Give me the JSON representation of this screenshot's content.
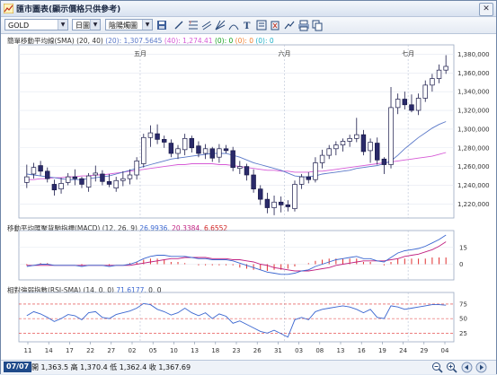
{
  "window": {
    "title": "匯市圖表(顯示價格只供參考)",
    "close_label": "✕"
  },
  "toolbar": {
    "symbol": "GOLD",
    "period": "日圖",
    "chart_style": "陰陽燭圖"
  },
  "price_panel": {
    "indicator_name": "簡單移動平均線(SMA) (20, 40)",
    "val_20": "(20): 1,307.5645",
    "val_40": "(40): 1,274.41",
    "z1": "(0): 0",
    "z2": "(0): 0",
    "z3": "(0): 0",
    "month_labels": [
      "五月",
      "六月",
      "七月"
    ],
    "price_labels": [
      "1,380,000",
      "1,360,000",
      "1,340,000",
      "1,320,000",
      "1,300,000",
      "1,280,000",
      "1,260,000",
      "1,240,000",
      "1,220,000"
    ]
  },
  "macd_panel": {
    "title": "移動平均匯聚背馳指標(MACD) (12, 26, 9)",
    "v1": "26.9936,",
    "v2": "20.3384,",
    "v3": "6.6552",
    "axis_labels": [
      "15",
      "0"
    ]
  },
  "rsi_panel": {
    "title": "相對強弱指數(RSI-SMA) (14, 0, 0)",
    "v1": "71.6177,",
    "v2": "0, 0",
    "axis_labels": [
      "75",
      "50",
      "25"
    ]
  },
  "date_axis": [
    "11",
    "14",
    "17",
    "22",
    "27",
    "02",
    "05",
    "10",
    "13",
    "18",
    "23",
    "26",
    "31",
    "03",
    "08",
    "13",
    "16",
    "19",
    "24",
    "29",
    "04"
  ],
  "status": {
    "date": "07/07",
    "quote": "開 1,363.5 高 1,370.4 低 1,362.4 收 1,367.69"
  },
  "colors": {
    "up_candle": "#ffffff",
    "down_candle": "#2a2a6a",
    "sma20": "#5a78c8",
    "sma40": "#d65ad6",
    "macd": "#3a66d0",
    "signal": "#c02080",
    "histogram": "#e03030",
    "rsi": "#3a66d0",
    "rsi_levels": "#e03030"
  },
  "chart_data": {
    "type": "candlestick",
    "symbol": "GOLD",
    "interval": "daily",
    "ylim": [
      1205,
      1390
    ],
    "candles": [
      {
        "o": 1243,
        "h": 1262,
        "l": 1237,
        "c": 1249
      },
      {
        "o": 1252,
        "h": 1264,
        "l": 1247,
        "c": 1259
      },
      {
        "o": 1261,
        "h": 1266,
        "l": 1250,
        "c": 1255
      },
      {
        "o": 1255,
        "h": 1259,
        "l": 1243,
        "c": 1247
      },
      {
        "o": 1241,
        "h": 1246,
        "l": 1229,
        "c": 1235
      },
      {
        "o": 1236,
        "h": 1248,
        "l": 1231,
        "c": 1242
      },
      {
        "o": 1243,
        "h": 1253,
        "l": 1240,
        "c": 1249
      },
      {
        "o": 1249,
        "h": 1257,
        "l": 1240,
        "c": 1247
      },
      {
        "o": 1247,
        "h": 1249,
        "l": 1237,
        "c": 1241
      },
      {
        "o": 1238,
        "h": 1253,
        "l": 1233,
        "c": 1250
      },
      {
        "o": 1251,
        "h": 1261,
        "l": 1244,
        "c": 1253
      },
      {
        "o": 1252,
        "h": 1256,
        "l": 1240,
        "c": 1244
      },
      {
        "o": 1244,
        "h": 1252,
        "l": 1238,
        "c": 1241
      },
      {
        "o": 1237,
        "h": 1249,
        "l": 1233,
        "c": 1245
      },
      {
        "o": 1245,
        "h": 1255,
        "l": 1239,
        "c": 1247
      },
      {
        "o": 1247,
        "h": 1257,
        "l": 1241,
        "c": 1251
      },
      {
        "o": 1251,
        "h": 1270,
        "l": 1246,
        "c": 1266
      },
      {
        "o": 1263,
        "h": 1295,
        "l": 1259,
        "c": 1291
      },
      {
        "o": 1291,
        "h": 1304,
        "l": 1281,
        "c": 1296
      },
      {
        "o": 1295,
        "h": 1305,
        "l": 1284,
        "c": 1289
      },
      {
        "o": 1289,
        "h": 1293,
        "l": 1280,
        "c": 1286
      },
      {
        "o": 1285,
        "h": 1289,
        "l": 1270,
        "c": 1274
      },
      {
        "o": 1274,
        "h": 1283,
        "l": 1268,
        "c": 1279
      },
      {
        "o": 1278,
        "h": 1295,
        "l": 1272,
        "c": 1290
      },
      {
        "o": 1290,
        "h": 1293,
        "l": 1275,
        "c": 1280
      },
      {
        "o": 1282,
        "h": 1287,
        "l": 1270,
        "c": 1274
      },
      {
        "o": 1274,
        "h": 1284,
        "l": 1268,
        "c": 1279
      },
      {
        "o": 1279,
        "h": 1281,
        "l": 1265,
        "c": 1269
      },
      {
        "o": 1270,
        "h": 1284,
        "l": 1264,
        "c": 1279
      },
      {
        "o": 1279,
        "h": 1283,
        "l": 1274,
        "c": 1277
      },
      {
        "o": 1277,
        "h": 1281,
        "l": 1255,
        "c": 1259
      },
      {
        "o": 1258,
        "h": 1266,
        "l": 1252,
        "c": 1260
      },
      {
        "o": 1260,
        "h": 1263,
        "l": 1245,
        "c": 1251
      },
      {
        "o": 1251,
        "h": 1257,
        "l": 1232,
        "c": 1236
      },
      {
        "o": 1236,
        "h": 1240,
        "l": 1219,
        "c": 1225
      },
      {
        "o": 1225,
        "h": 1232,
        "l": 1210,
        "c": 1216
      },
      {
        "o": 1216,
        "h": 1229,
        "l": 1208,
        "c": 1222
      },
      {
        "o": 1222,
        "h": 1228,
        "l": 1211,
        "c": 1219
      },
      {
        "o": 1219,
        "h": 1224,
        "l": 1212,
        "c": 1217
      },
      {
        "o": 1215,
        "h": 1245,
        "l": 1212,
        "c": 1241
      },
      {
        "o": 1241,
        "h": 1252,
        "l": 1236,
        "c": 1249
      },
      {
        "o": 1249,
        "h": 1254,
        "l": 1242,
        "c": 1246
      },
      {
        "o": 1246,
        "h": 1270,
        "l": 1243,
        "c": 1264
      },
      {
        "o": 1264,
        "h": 1278,
        "l": 1258,
        "c": 1272
      },
      {
        "o": 1272,
        "h": 1283,
        "l": 1268,
        "c": 1279
      },
      {
        "o": 1279,
        "h": 1287,
        "l": 1272,
        "c": 1283
      },
      {
        "o": 1283,
        "h": 1290,
        "l": 1276,
        "c": 1287
      },
      {
        "o": 1287,
        "h": 1294,
        "l": 1281,
        "c": 1290
      },
      {
        "o": 1290,
        "h": 1312,
        "l": 1286,
        "c": 1294
      },
      {
        "o": 1294,
        "h": 1299,
        "l": 1272,
        "c": 1276
      },
      {
        "o": 1277,
        "h": 1290,
        "l": 1264,
        "c": 1286
      },
      {
        "o": 1285,
        "h": 1291,
        "l": 1262,
        "c": 1267
      },
      {
        "o": 1268,
        "h": 1270,
        "l": 1252,
        "c": 1262
      },
      {
        "o": 1262,
        "h": 1345,
        "l": 1258,
        "c": 1323
      },
      {
        "o": 1323,
        "h": 1338,
        "l": 1316,
        "c": 1332
      },
      {
        "o": 1332,
        "h": 1340,
        "l": 1321,
        "c": 1326
      },
      {
        "o": 1326,
        "h": 1337,
        "l": 1318,
        "c": 1320
      },
      {
        "o": 1320,
        "h": 1338,
        "l": 1315,
        "c": 1333
      },
      {
        "o": 1333,
        "h": 1352,
        "l": 1329,
        "c": 1347
      },
      {
        "o": 1347,
        "h": 1359,
        "l": 1340,
        "c": 1354
      },
      {
        "o": 1354,
        "h": 1369,
        "l": 1349,
        "c": 1363
      },
      {
        "o": 1363,
        "h": 1379,
        "l": 1359,
        "c": 1367
      }
    ],
    "sma20": [
      1252,
      1251,
      1250,
      1249,
      1248,
      1247,
      1246,
      1246,
      1246,
      1247,
      1248,
      1249,
      1250,
      1252,
      1254,
      1256,
      1258,
      1260,
      1262,
      1264,
      1266,
      1268,
      1269,
      1270,
      1271,
      1272,
      1273,
      1274,
      1274,
      1274,
      1272,
      1270,
      1267,
      1264,
      1262,
      1260,
      1258,
      1256,
      1253,
      1250,
      1249,
      1249,
      1250,
      1252,
      1253,
      1254,
      1255,
      1256,
      1258,
      1259,
      1260,
      1261,
      1263,
      1266,
      1272,
      1279,
      1285,
      1291,
      1296,
      1301,
      1305,
      1308
    ],
    "sma40": [
      1246,
      1246,
      1247,
      1247,
      1248,
      1248,
      1249,
      1249,
      1250,
      1250,
      1251,
      1251,
      1252,
      1253,
      1254,
      1255,
      1256,
      1257,
      1258,
      1259,
      1260,
      1261,
      1262,
      1262,
      1263,
      1263,
      1263,
      1263,
      1262,
      1262,
      1261,
      1260,
      1259,
      1258,
      1257,
      1256,
      1256,
      1255,
      1255,
      1254,
      1254,
      1254,
      1255,
      1255,
      1256,
      1257,
      1258,
      1259,
      1260,
      1261,
      1262,
      1263,
      1264,
      1265,
      1266,
      1267,
      1268,
      1269,
      1270,
      1271,
      1273,
      1275
    ],
    "macd": {
      "ylim": [
        -14,
        30
      ],
      "macd": [
        -2,
        -1,
        0,
        0,
        -1,
        -1,
        -1,
        -1,
        -2,
        -1,
        -1,
        -1,
        -2,
        -1,
        -1,
        0,
        2,
        5,
        7,
        8,
        8,
        7,
        7,
        7,
        6,
        5,
        5,
        4,
        4,
        4,
        3,
        1,
        -1,
        -3,
        -5,
        -7,
        -8,
        -9,
        -9,
        -8,
        -6,
        -5,
        -2,
        0,
        2,
        4,
        5,
        6,
        7,
        5,
        5,
        3,
        2,
        6,
        10,
        12,
        13,
        14,
        16,
        19,
        22,
        26
      ],
      "signal": [
        -1,
        -1,
        -1,
        -1,
        -1,
        -1,
        -1,
        -1,
        -1,
        -1,
        -1,
        -1,
        -1,
        -1,
        -1,
        -1,
        0,
        1,
        2,
        3,
        4,
        5,
        5,
        6,
        6,
        6,
        6,
        5,
        5,
        5,
        4,
        4,
        3,
        2,
        0,
        -1,
        -3,
        -4,
        -5,
        -6,
        -6,
        -6,
        -5,
        -4,
        -3,
        -1,
        0,
        1,
        2,
        3,
        3,
        3,
        3,
        4,
        5,
        7,
        8,
        9,
        11,
        13,
        16,
        20
      ],
      "histogram": [
        -1,
        0,
        1,
        1,
        0,
        0,
        0,
        0,
        -1,
        0,
        0,
        0,
        -1,
        0,
        0,
        1,
        2,
        4,
        5,
        5,
        4,
        2,
        2,
        1,
        0,
        -1,
        -1,
        -1,
        -1,
        -1,
        -1,
        -3,
        -4,
        -5,
        -5,
        -6,
        -5,
        -5,
        -4,
        -2,
        0,
        1,
        3,
        4,
        5,
        5,
        5,
        5,
        5,
        2,
        2,
        0,
        -1,
        2,
        5,
        5,
        5,
        5,
        5,
        6,
        6,
        6
      ]
    },
    "rsi": {
      "ylim": [
        10,
        95
      ],
      "levels": [
        75,
        50,
        25
      ],
      "values": [
        55,
        62,
        58,
        52,
        45,
        50,
        57,
        55,
        48,
        60,
        62,
        52,
        50,
        57,
        60,
        63,
        68,
        76,
        74,
        66,
        62,
        56,
        60,
        68,
        60,
        55,
        60,
        50,
        58,
        54,
        42,
        46,
        40,
        34,
        28,
        25,
        30,
        24,
        18,
        48,
        52,
        48,
        62,
        66,
        68,
        70,
        72,
        70,
        66,
        60,
        66,
        52,
        50,
        72,
        70,
        66,
        68,
        70,
        72,
        74,
        74,
        73
      ]
    }
  }
}
